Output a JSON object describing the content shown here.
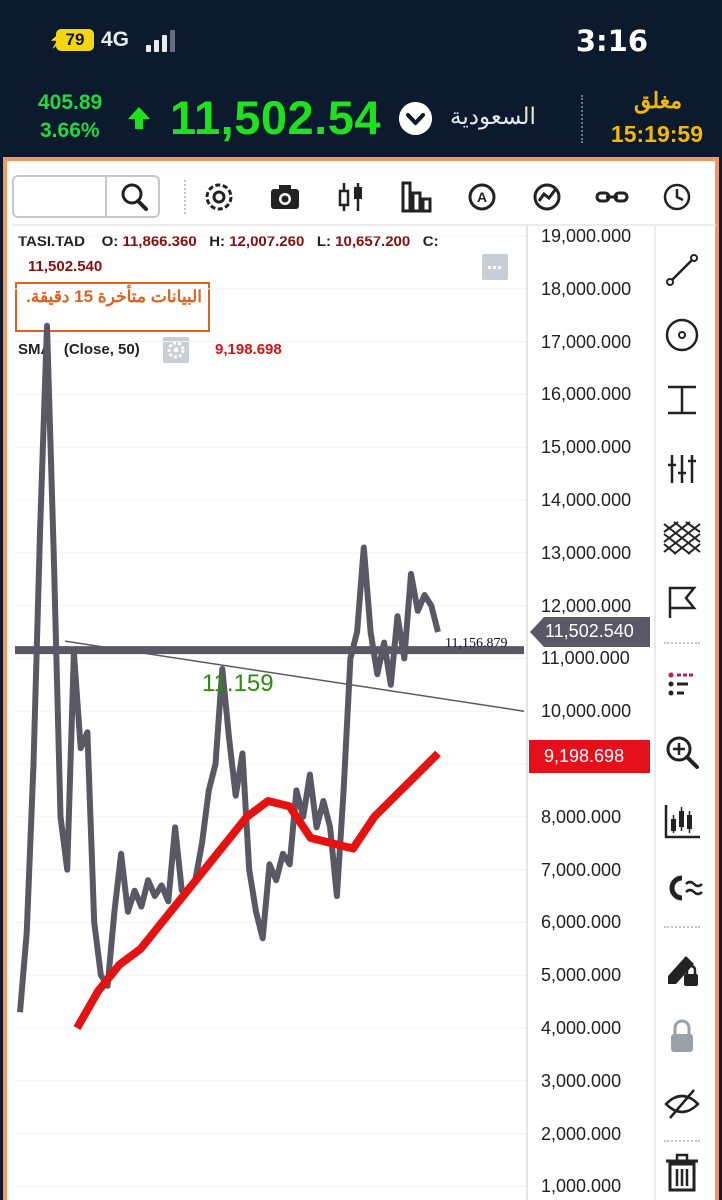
{
  "status_bar": {
    "battery": "79",
    "network": "4G",
    "time": "3:16"
  },
  "quote": {
    "change": "405.89",
    "change_pct": "3.66%",
    "price": "11,502.54",
    "market": "السعودية",
    "state": "مغلق",
    "clock": "15:19:59",
    "up_color": "#1fe21f",
    "state_color": "#f5b800"
  },
  "toolbar": {
    "search_value": "",
    "icons": [
      "search-icon",
      "settings-icon",
      "camera-icon",
      "candles-icon",
      "bars-icon",
      "alert-icon",
      "indicator-icon",
      "compare-icon",
      "clock-icon"
    ]
  },
  "right_toolbar": {
    "icons": [
      "line-tool-icon",
      "circle-tool-icon",
      "measure-tool-icon",
      "fib-tool-icon",
      "pattern-tool-icon",
      "flag-icon",
      "list-icon",
      "zoom-in-icon",
      "chart-type-icon",
      "magnet-icon",
      "pencil-lock-icon",
      "lock-icon",
      "eye-hide-icon",
      "trash-icon"
    ]
  },
  "legend": {
    "symbol": "TASI.TAD",
    "o_label": "O:",
    "o_value": "11,866.360",
    "h_label": "H:",
    "h_value": "12,007.260",
    "l_label": "L:",
    "l_value": "10,657.200",
    "c_label": "C:",
    "c_value": "11,502.540",
    "delay_notice": "البيانات متأخرة 15 دقيقة.",
    "sma_label": "SMA",
    "sma_params": "(Close, 50)",
    "sma_value": "9,198.698"
  },
  "price_axis": {
    "ticks": [
      "19,000.000",
      "18,000.000",
      "17,000.000",
      "16,000.000",
      "15,000.000",
      "14,000.000",
      "13,000.000",
      "12,000.000",
      "11,000.000",
      "10,000.000",
      "9,000.000",
      "8,000.000",
      "7,000.000",
      "6,000.000",
      "5,000.000",
      "4,000.000",
      "3,000.000",
      "2,000.000",
      "1,000.000"
    ],
    "last_price_tag": "11,502.540",
    "sma_tag": "9,198.698",
    "hline_label": "11,156.879",
    "trend_label": "11.159",
    "colors": {
      "price_line": "#5b5866",
      "sma_line": "#e61212",
      "sma_tag": "#e6101c",
      "trend_label": "#2a8d0a",
      "frame": "#f29866"
    }
  },
  "chart_data": {
    "type": "line",
    "title": "",
    "xlabel": "",
    "ylabel": "",
    "ylim": [
      1000,
      19000
    ],
    "y_ticks": [
      19000,
      18000,
      17000,
      16000,
      15000,
      14000,
      13000,
      12000,
      11000,
      10000,
      9000,
      8000,
      7000,
      6000,
      5000,
      4000,
      3000,
      2000,
      1000
    ],
    "series": [
      {
        "name": "TASI.TAD",
        "values": [
          4300,
          5800,
          9000,
          13500,
          17300,
          13000,
          8000,
          7000,
          11100,
          9300,
          9600,
          6000,
          5000,
          4800,
          6200,
          7300,
          6200,
          6600,
          6300,
          6800,
          6500,
          6700,
          6400,
          7800,
          6600,
          6600,
          6800,
          7500,
          8500,
          9000,
          10800,
          9500,
          8400,
          9200,
          7000,
          6200,
          5700,
          7100,
          6800,
          7300,
          7100,
          8500,
          8000,
          8800,
          7800,
          8300,
          7800,
          6500,
          8500,
          11000,
          11500,
          13100,
          11500,
          10700,
          11300,
          10500,
          11800,
          11000,
          12600,
          11900,
          12200,
          12000,
          11500
        ]
      },
      {
        "name": "SMA (Close, 50)",
        "values": [
          4000,
          4700,
          5200,
          5500,
          6000,
          6500,
          7000,
          7500,
          8000,
          8300,
          8200,
          7600,
          7500,
          7400,
          8000,
          8400,
          8800,
          9200
        ]
      }
    ],
    "hline": 11156.879,
    "trendline": [
      [
        0,
        11100
      ],
      [
        1,
        10000
      ]
    ],
    "annotations": [
      "11.159",
      "11,156.879"
    ]
  }
}
